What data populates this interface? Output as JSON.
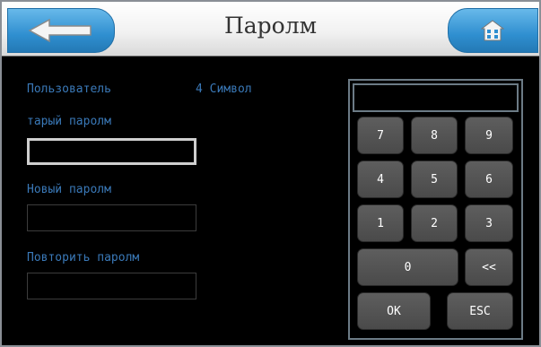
{
  "header": {
    "title": "Паролм",
    "back_icon": "back-arrow-icon",
    "home_icon": "home-icon"
  },
  "form": {
    "user_label": "Пользователь",
    "user_value": "4 Символ",
    "old_password_label": "тарый паролм",
    "old_password_value": "",
    "new_password_label": "Новый паролм",
    "new_password_value": "",
    "repeat_password_label": "Повторить паролм",
    "repeat_password_value": ""
  },
  "keypad": {
    "display_value": "",
    "keys": {
      "k7": "7",
      "k8": "8",
      "k9": "9",
      "k4": "4",
      "k5": "5",
      "k6": "6",
      "k1": "1",
      "k2": "2",
      "k3": "3",
      "k0": "0",
      "backspace": "<<",
      "ok": "OK",
      "esc": "ESC"
    }
  },
  "colors": {
    "accent_blue": "#2f8fd0",
    "label_blue": "#3a79b8",
    "key_gray": "#555555",
    "background": "#000000"
  }
}
